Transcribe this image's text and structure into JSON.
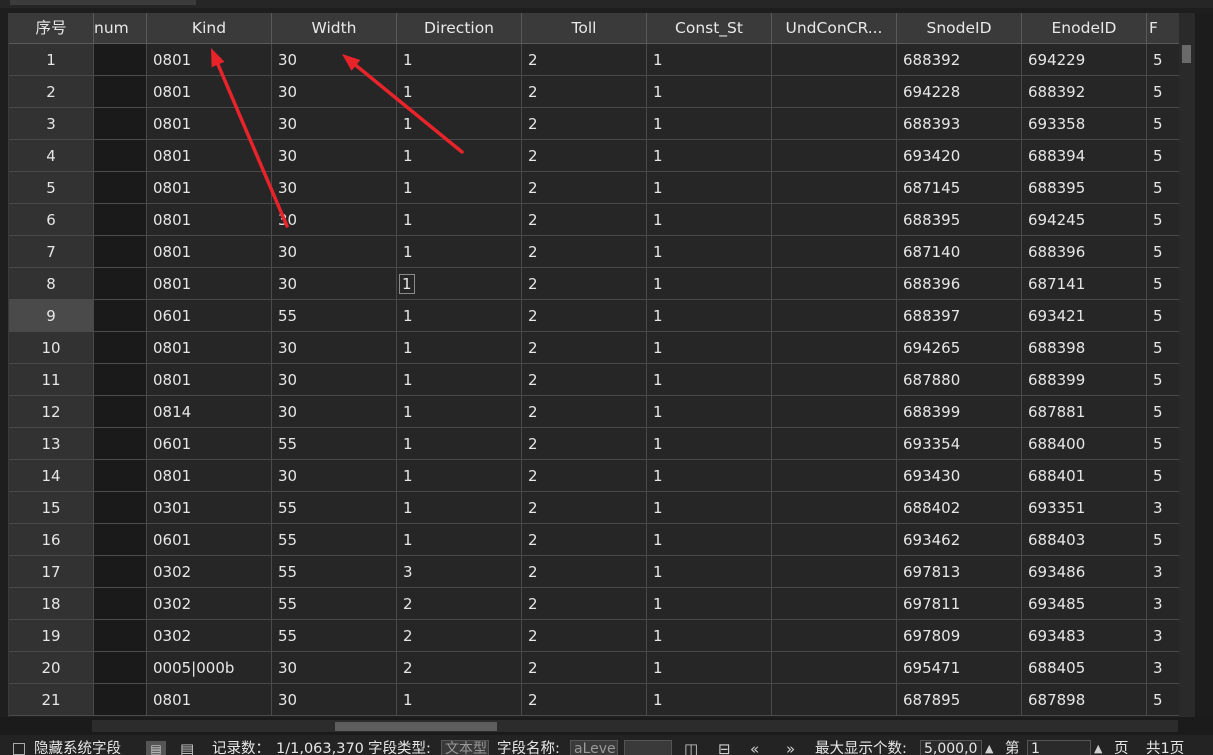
{
  "columns": [
    {
      "label": "序号"
    },
    {
      "label": "num"
    },
    {
      "label": "Kind"
    },
    {
      "label": "Width"
    },
    {
      "label": "Direction"
    },
    {
      "label": "Toll"
    },
    {
      "label": "Const_St"
    },
    {
      "label": "UndConCR..."
    },
    {
      "label": "SnodeID"
    },
    {
      "label": "EnodeID"
    },
    {
      "label": "F"
    }
  ],
  "rows": [
    {
      "idx": "1",
      "kind": "0801",
      "width": "30",
      "direction": "1",
      "toll": "2",
      "const_st": "1",
      "undconcr": "",
      "snode": "688392",
      "enode": "694229",
      "f": "5"
    },
    {
      "idx": "2",
      "kind": "0801",
      "width": "30",
      "direction": "1",
      "toll": "2",
      "const_st": "1",
      "undconcr": "",
      "snode": "694228",
      "enode": "688392",
      "f": "5"
    },
    {
      "idx": "3",
      "kind": "0801",
      "width": "30",
      "direction": "1",
      "toll": "2",
      "const_st": "1",
      "undconcr": "",
      "snode": "688393",
      "enode": "693358",
      "f": "5"
    },
    {
      "idx": "4",
      "kind": "0801",
      "width": "30",
      "direction": "1",
      "toll": "2",
      "const_st": "1",
      "undconcr": "",
      "snode": "693420",
      "enode": "688394",
      "f": "5"
    },
    {
      "idx": "5",
      "kind": "0801",
      "width": "30",
      "direction": "1",
      "toll": "2",
      "const_st": "1",
      "undconcr": "",
      "snode": "687145",
      "enode": "688395",
      "f": "5"
    },
    {
      "idx": "6",
      "kind": "0801",
      "width": "30",
      "direction": "1",
      "toll": "2",
      "const_st": "1",
      "undconcr": "",
      "snode": "688395",
      "enode": "694245",
      "f": "5"
    },
    {
      "idx": "7",
      "kind": "0801",
      "width": "30",
      "direction": "1",
      "toll": "2",
      "const_st": "1",
      "undconcr": "",
      "snode": "687140",
      "enode": "688396",
      "f": "5"
    },
    {
      "idx": "8",
      "kind": "0801",
      "width": "30",
      "direction": "1",
      "toll": "2",
      "const_st": "1",
      "undconcr": "",
      "snode": "688396",
      "enode": "687141",
      "f": "5"
    },
    {
      "idx": "9",
      "kind": "0601",
      "width": "55",
      "direction": "1",
      "toll": "2",
      "const_st": "1",
      "undconcr": "",
      "snode": "688397",
      "enode": "693421",
      "f": "5"
    },
    {
      "idx": "10",
      "kind": "0801",
      "width": "30",
      "direction": "1",
      "toll": "2",
      "const_st": "1",
      "undconcr": "",
      "snode": "694265",
      "enode": "688398",
      "f": "5"
    },
    {
      "idx": "11",
      "kind": "0801",
      "width": "30",
      "direction": "1",
      "toll": "2",
      "const_st": "1",
      "undconcr": "",
      "snode": "687880",
      "enode": "688399",
      "f": "5"
    },
    {
      "idx": "12",
      "kind": "0814",
      "width": "30",
      "direction": "1",
      "toll": "2",
      "const_st": "1",
      "undconcr": "",
      "snode": "688399",
      "enode": "687881",
      "f": "5"
    },
    {
      "idx": "13",
      "kind": "0601",
      "width": "55",
      "direction": "1",
      "toll": "2",
      "const_st": "1",
      "undconcr": "",
      "snode": "693354",
      "enode": "688400",
      "f": "5"
    },
    {
      "idx": "14",
      "kind": "0801",
      "width": "30",
      "direction": "1",
      "toll": "2",
      "const_st": "1",
      "undconcr": "",
      "snode": "693430",
      "enode": "688401",
      "f": "5"
    },
    {
      "idx": "15",
      "kind": "0301",
      "width": "55",
      "direction": "1",
      "toll": "2",
      "const_st": "1",
      "undconcr": "",
      "snode": "688402",
      "enode": "693351",
      "f": "3"
    },
    {
      "idx": "16",
      "kind": "0601",
      "width": "55",
      "direction": "1",
      "toll": "2",
      "const_st": "1",
      "undconcr": "",
      "snode": "693462",
      "enode": "688403",
      "f": "5"
    },
    {
      "idx": "17",
      "kind": "0302",
      "width": "55",
      "direction": "3",
      "toll": "2",
      "const_st": "1",
      "undconcr": "",
      "snode": "697813",
      "enode": "693486",
      "f": "3"
    },
    {
      "idx": "18",
      "kind": "0302",
      "width": "55",
      "direction": "2",
      "toll": "2",
      "const_st": "1",
      "undconcr": "",
      "snode": "697811",
      "enode": "693485",
      "f": "3"
    },
    {
      "idx": "19",
      "kind": "0302",
      "width": "55",
      "direction": "2",
      "toll": "2",
      "const_st": "1",
      "undconcr": "",
      "snode": "697809",
      "enode": "693483",
      "f": "3"
    },
    {
      "idx": "20",
      "kind": "0005|000b",
      "width": "30",
      "direction": "2",
      "toll": "2",
      "const_st": "1",
      "undconcr": "",
      "snode": "695471",
      "enode": "688405",
      "f": "3"
    },
    {
      "idx": "21",
      "kind": "0801",
      "width": "30",
      "direction": "1",
      "toll": "2",
      "const_st": "1",
      "undconcr": "",
      "snode": "687895",
      "enode": "687898",
      "f": "5"
    }
  ],
  "selected_row_index": "9",
  "focused_cell": {
    "row": "8",
    "column": "Direction"
  },
  "statusbar": {
    "hide_system_fields": "隐藏系统字段",
    "record_count_label": "记录数：",
    "record_count_value": "1/1,063,370",
    "field_type_label": "字段类型:",
    "field_type_value": "文本型",
    "field_name_label": "字段名称:",
    "field_name_value": "aLevel",
    "max_display_label": "最大显示个数:",
    "max_display_value": "5,000,0",
    "page_prefix": "第",
    "page_value": "1",
    "page_suffix": "页",
    "total_pages": "共1页"
  },
  "annotation_color": "#e8242a"
}
